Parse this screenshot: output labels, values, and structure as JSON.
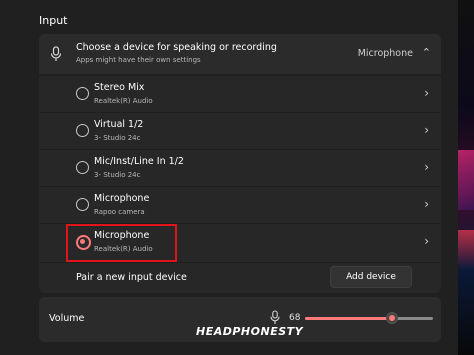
{
  "section": {
    "title": "Input"
  },
  "input_header": {
    "title": "Choose a device for speaking or recording",
    "subtitle": "Apps might have their own settings",
    "selected_value": "Microphone",
    "icon": "microphone-icon",
    "expand_icon": "chevron-up-icon"
  },
  "devices": [
    {
      "name": "Stereo Mix",
      "detail": "Realtek(R) Audio",
      "selected": false
    },
    {
      "name": "Virtual 1/2",
      "detail": "3- Studio 24c",
      "selected": false
    },
    {
      "name": "Mic/Inst/Line In 1/2",
      "detail": "3- Studio 24c",
      "selected": false
    },
    {
      "name": "Microphone",
      "detail": "Rapoo  camera",
      "selected": false
    },
    {
      "name": "Microphone",
      "detail": "Realtek(R) Audio",
      "selected": true
    }
  ],
  "pair": {
    "label": "Pair a new input device",
    "button_label": "Add device"
  },
  "volume": {
    "label": "Volume",
    "value": "68",
    "level_percent": 68,
    "icon": "microphone-icon"
  },
  "watermark": "HEADPHONESTY",
  "colors": {
    "accent": "#ff7a7a",
    "highlight_border": "#e0141c",
    "background": "#202020",
    "card": "#2b2b2b"
  }
}
